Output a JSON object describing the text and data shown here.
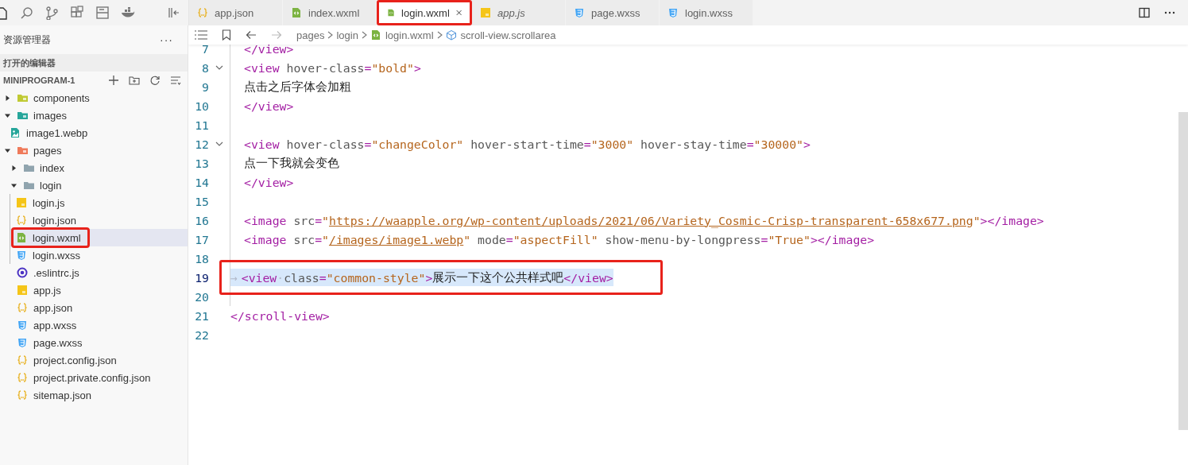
{
  "tabs": [
    {
      "label": "app.json",
      "kind": "json",
      "selected": false,
      "italic": false,
      "annotated": false
    },
    {
      "label": "index.wxml",
      "kind": "wxml",
      "selected": false,
      "italic": false,
      "annotated": false
    },
    {
      "label": "login.wxml",
      "kind": "wxml",
      "selected": true,
      "italic": false,
      "annotated": true
    },
    {
      "label": "app.js",
      "kind": "js",
      "selected": false,
      "italic": true,
      "annotated": false
    },
    {
      "label": "page.wxss",
      "kind": "wxss",
      "selected": false,
      "italic": false,
      "annotated": false
    },
    {
      "label": "login.wxss",
      "kind": "wxss",
      "selected": false,
      "italic": false,
      "annotated": false
    }
  ],
  "sidebar": {
    "title": "资源管理器",
    "more": "···",
    "open_editors": "打开的编辑器",
    "project": "MINIPROGRAM-1",
    "tree": [
      {
        "label": "components",
        "kind": "components",
        "expanded": false,
        "selected": false
      },
      {
        "label": "images",
        "kind": "images",
        "expanded": true,
        "selected": false,
        "children": [
          {
            "label": "image1.webp",
            "kind": "image",
            "selected": false
          }
        ]
      },
      {
        "label": "pages",
        "kind": "pages",
        "expanded": true,
        "selected": false,
        "children": [
          {
            "label": "index",
            "kind": "folder",
            "expanded": false,
            "selected": false
          },
          {
            "label": "login",
            "kind": "folder",
            "expanded": true,
            "selected": false,
            "children": [
              {
                "label": "login.js",
                "kind": "js",
                "selected": false,
                "annotated": false
              },
              {
                "label": "login.json",
                "kind": "json",
                "selected": false,
                "annotated": false
              },
              {
                "label": "login.wxml",
                "kind": "wxml",
                "selected": true,
                "annotated": true
              },
              {
                "label": "login.wxss",
                "kind": "wxss",
                "selected": false,
                "annotated": false
              }
            ]
          }
        ]
      },
      {
        "label": ".eslintrc.js",
        "kind": "eslint",
        "selected": false
      },
      {
        "label": "app.js",
        "kind": "js",
        "selected": false
      },
      {
        "label": "app.json",
        "kind": "json",
        "selected": false
      },
      {
        "label": "app.wxss",
        "kind": "wxss",
        "selected": false
      },
      {
        "label": "page.wxss",
        "kind": "wxss",
        "selected": false
      },
      {
        "label": "project.config.json",
        "kind": "json",
        "selected": false
      },
      {
        "label": "project.private.config.json",
        "kind": "json",
        "selected": false
      },
      {
        "label": "sitemap.json",
        "kind": "json",
        "selected": false
      }
    ]
  },
  "breadcrumb": [
    {
      "label": "pages"
    },
    {
      "label": "login"
    },
    {
      "label": "login.wxml",
      "kind": "wxml"
    },
    {
      "label": "scroll-view.scrollarea",
      "kind": "cube"
    }
  ],
  "editor": {
    "lines": [
      {
        "number": "7",
        "kind": "inner",
        "fold": false,
        "highlighted": false,
        "annotated": false,
        "text": "</view>"
      },
      {
        "number": "8",
        "kind": "inner",
        "fold": true,
        "highlighted": false,
        "annotated": false,
        "text": "<view hover-class=\"bold\">"
      },
      {
        "number": "9",
        "kind": "inner",
        "fold": false,
        "highlighted": false,
        "annotated": false,
        "text": "点击之后字体会加粗"
      },
      {
        "number": "10",
        "kind": "inner",
        "fold": false,
        "highlighted": false,
        "annotated": false,
        "text": "</view>"
      },
      {
        "number": "11",
        "kind": "inner",
        "fold": false,
        "highlighted": false,
        "annotated": false
      },
      {
        "number": "12",
        "kind": "inner",
        "fold": true,
        "highlighted": false,
        "annotated": false,
        "text": "<view hover-class=\"changeColor\" hover-start-time=\"3000\" hover-stay-time=\"30000\">"
      },
      {
        "number": "13",
        "kind": "inner",
        "fold": false,
        "highlighted": false,
        "annotated": false,
        "text": "点一下我就会变色"
      },
      {
        "number": "14",
        "kind": "inner",
        "fold": false,
        "highlighted": false,
        "annotated": false,
        "text": "</view>"
      },
      {
        "number": "15",
        "kind": "inner",
        "fold": false,
        "highlighted": false,
        "annotated": false
      },
      {
        "number": "16",
        "kind": "inner",
        "fold": false,
        "highlighted": false,
        "annotated": false,
        "text": "<image src=\"https://waapple.org/wp-content/uploads/2021/06/Variety_Cosmic-Crisp-transparent-658x677.png\"></image>"
      },
      {
        "number": "17",
        "kind": "inner",
        "fold": false,
        "highlighted": false,
        "annotated": false,
        "text": "<image src=\"/images/image1.webp\" mode=\"aspectFill\" show-menu-by-longpress=\"True\"></image>"
      },
      {
        "number": "18",
        "kind": "inner",
        "fold": false,
        "highlighted": false,
        "annotated": false
      },
      {
        "number": "19",
        "kind": "marked",
        "fold": false,
        "highlighted": true,
        "annotated": true,
        "text": "→ <view·class=\"common-style\">展示一下这个公共样式吧</view>"
      },
      {
        "number": "20",
        "kind": "inner",
        "fold": false,
        "highlighted": false,
        "annotated": false
      },
      {
        "number": "21",
        "kind": "outer",
        "fold": false,
        "highlighted": false,
        "annotated": false,
        "text": "</scroll-view>"
      },
      {
        "number": "22",
        "kind": "outer",
        "fold": false,
        "highlighted": false,
        "annotated": false
      }
    ]
  }
}
